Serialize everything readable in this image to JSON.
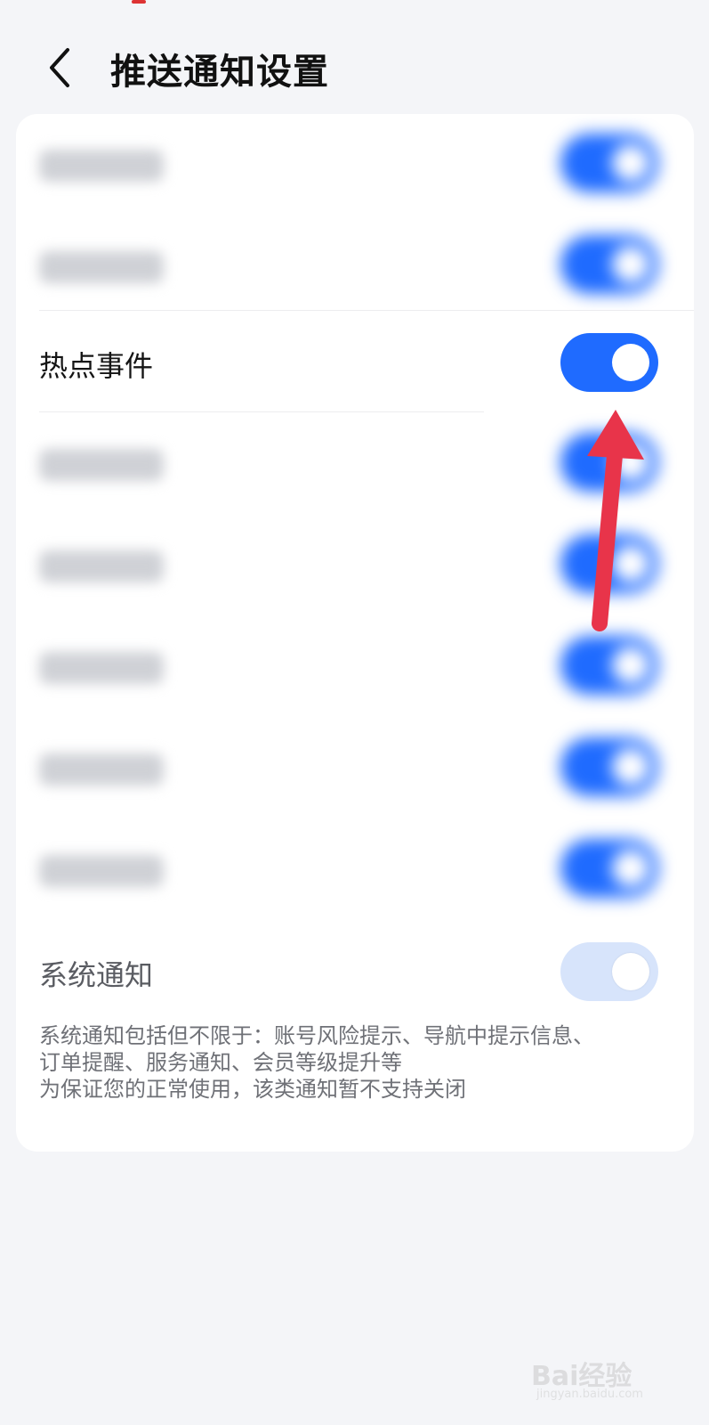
{
  "header": {
    "title": "推送通知设置",
    "back_icon": "chevron-left-icon"
  },
  "settings": [
    {
      "label": "",
      "blurred": true,
      "on": true
    },
    {
      "label": "",
      "blurred": true,
      "on": true
    },
    {
      "label": "热点事件",
      "blurred": false,
      "on": true
    },
    {
      "label": "",
      "blurred": true,
      "on": true
    },
    {
      "label": "",
      "blurred": true,
      "on": true
    },
    {
      "label": "",
      "blurred": true,
      "on": true
    },
    {
      "label": "",
      "blurred": true,
      "on": true
    },
    {
      "label": "",
      "blurred": true,
      "on": true
    }
  ],
  "system": {
    "label": "系统通知",
    "on": true,
    "disabled": true,
    "description_lines": [
      "系统通知包括但不限于：账号风险提示、导航中提示信息、",
      "订单提醒、服务通知、会员等级提升等",
      "为保证您的正常使用，该类通知暂不支持关闭"
    ]
  },
  "watermark": {
    "logo": "Bai经验",
    "sub": "jingyan.baidu.com"
  },
  "colors": {
    "accent": "#1f6bff",
    "arrow": "#e8344a",
    "background": "#f4f5f8"
  }
}
